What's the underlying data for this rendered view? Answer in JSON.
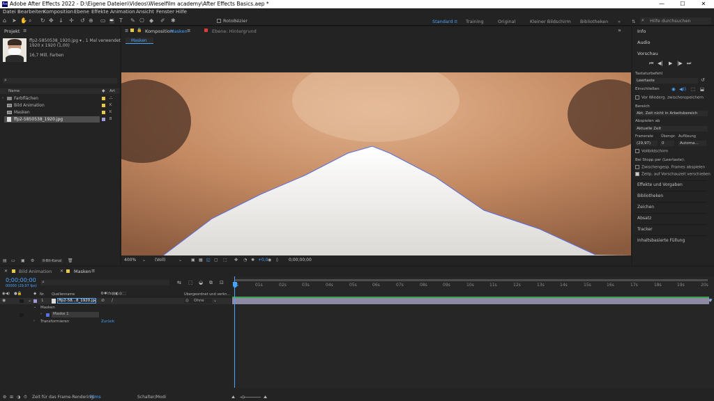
{
  "window": {
    "title": "Adobe After Effects 2022 - D:\\Eigene Dateien\\Videos\\Wieselfilm academy\\After Effects Basics.aep *",
    "minimize": "—",
    "maximize": "☐",
    "close": "✕",
    "app_badge": "Ae"
  },
  "menu": [
    "Datei",
    "Bearbeiten",
    "Komposition",
    "Ebene",
    "Effekte",
    "Animation",
    "Ansicht",
    "Fenster",
    "Hilfe"
  ],
  "toolbar": {
    "rotobezier_label": "RotoBézier",
    "workspaces": [
      "Standard",
      "Training",
      "Original",
      "Kleiner Bildschirm",
      "Bibliotheken"
    ],
    "active_workspace": "Standard",
    "search_placeholder": "Hilfe durchsuchen"
  },
  "project": {
    "title": "Projekt",
    "file_name": "ffp2-5850538_1920.jpg ▾ , 1 Mal verwendet",
    "dims": "1920 x 1920 (1,00)",
    "colors": "16,7 Mill. Farben",
    "col_name": "Name",
    "col_type": "Art",
    "items": [
      {
        "name": "Farbflächen",
        "type": "folder",
        "color": "#e6c84a"
      },
      {
        "name": "Bild Animation",
        "type": "comp",
        "color": "#e6c84a"
      },
      {
        "name": "Masken",
        "type": "comp",
        "color": "#e6c84a"
      },
      {
        "name": "ffp2-5850538_1920.jpg",
        "type": "image",
        "color": "#a09ad8"
      }
    ],
    "bitdepth": "8-Bit-Kanal"
  },
  "comp": {
    "tab_prefix": "Komposition",
    "tab_name": "Masken",
    "layer_tab": "Ebene: Hintergrund",
    "breadcrumb": "Masken",
    "zoom": "400%",
    "resolution": "(Voll)",
    "exposure": "+0,0",
    "timecode": "0;00;00;00"
  },
  "right": {
    "info": "Info",
    "audio": "Audio",
    "preview": "Vorschau",
    "shortcut_label": "Tastaturbefehl",
    "shortcut": "Leertaste",
    "include_label": "Einschließen",
    "before_play": "Vor Wiederg. zwischenspeichern",
    "range_label": "Bereich",
    "range": "Akt. Zeit nicht in Arbeitsbereich",
    "play_from_label": "Abspielen ab",
    "play_from": "Aktuelle Zeit",
    "fr_label": "Framerate",
    "skip_label": "Überspr.",
    "res_label": "Auflösung",
    "fr": "(29,97)",
    "skip": "0",
    "res": "Automa...",
    "fullscreen": "Vollbildschirm",
    "on_stop": "Bei Stopp per (Leertaste):",
    "cache_frames": "Zwischengesp. Frames abspielen",
    "move_time": "Zeitp. auf Vorschauzeit verschieben",
    "panels": [
      "Effekte und Vorgaben",
      "Bibliotheken",
      "Zeichen",
      "Absatz",
      "Tracker",
      "Inhaltsbasierte Füllung"
    ]
  },
  "timeline": {
    "tabs": [
      "Bild Animation",
      "Masken"
    ],
    "active_tab": "Masken",
    "timecode": "0;00;00;00",
    "fps": "00000 (29,97 fps)",
    "col_nr": "Nr.",
    "col_source": "Quellenname",
    "col_parent": "Übergeordnet und verkn...",
    "ruler": [
      "0s",
      "01s",
      "02s",
      "03s",
      "04s",
      "05s",
      "06s",
      "07s",
      "08s",
      "09s",
      "10s",
      "11s",
      "12s",
      "13s",
      "14s",
      "15s",
      "16s",
      "17s",
      "18s",
      "19s",
      "20s"
    ],
    "layer": {
      "num": "1",
      "name": "ffp2-58...8_1920.jpg",
      "parent": "Ohne"
    },
    "masks": "Masken",
    "mask1": "Maske 1",
    "transform": "Transformieren",
    "reset": "Zurück"
  },
  "status": {
    "render_label": "Zeit für das Frame-Rendering:",
    "render_time": "70ms",
    "switches": "Schalter/Modi"
  }
}
